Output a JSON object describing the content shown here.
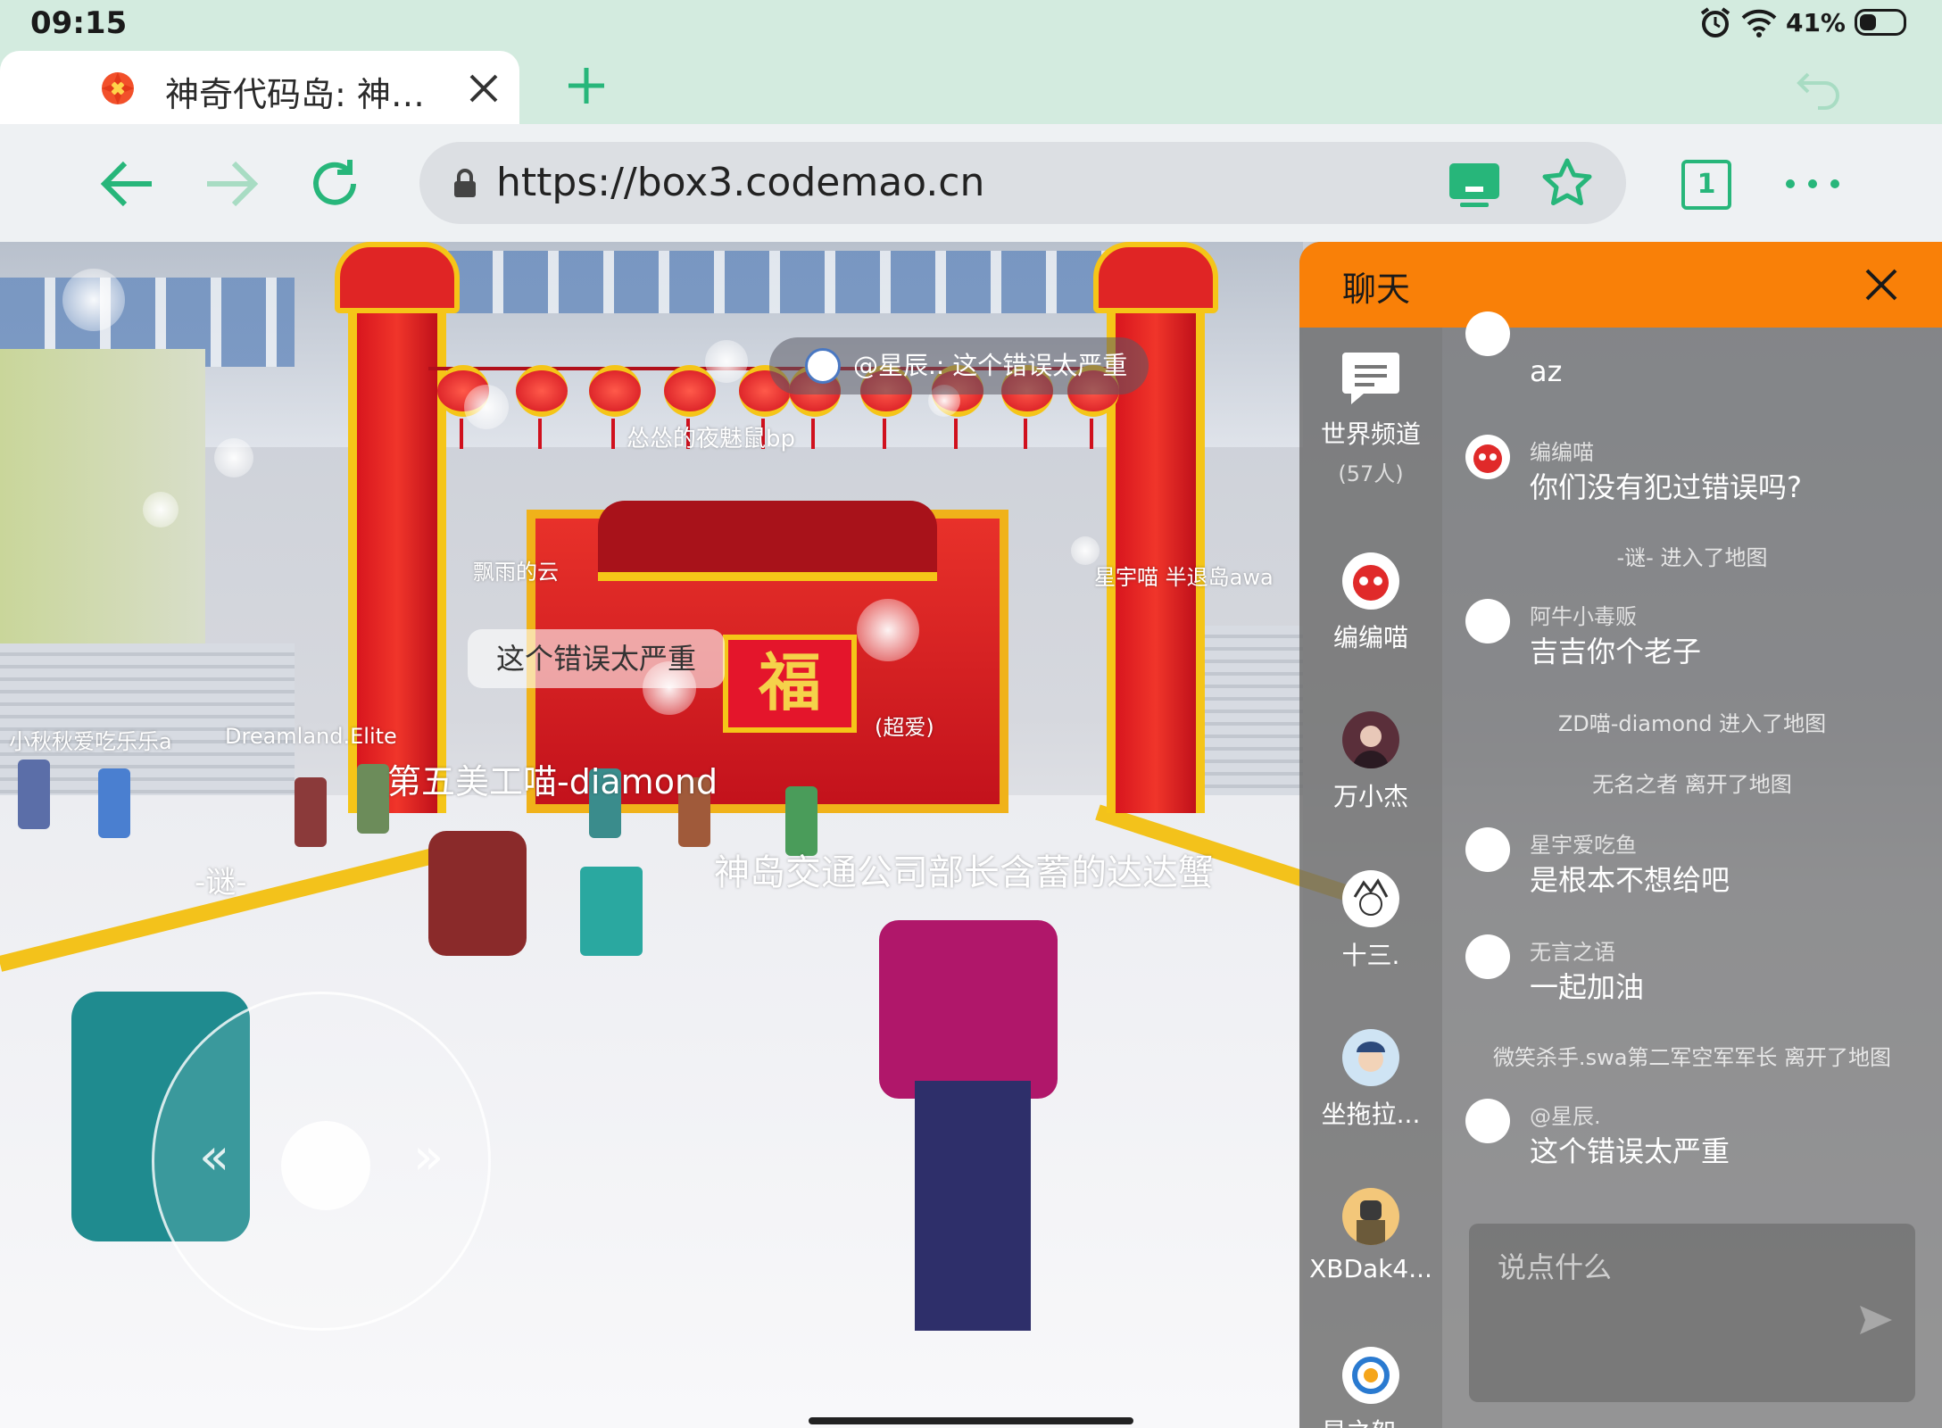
{
  "status": {
    "time": "09:15",
    "battery": "41%"
  },
  "tab": {
    "title": "神奇代码岛: 神…"
  },
  "address": {
    "url": "https://box3.codemao.cn",
    "tab_count": "1"
  },
  "game": {
    "top_bubble": "@星辰.: 这个错误太严重",
    "say_bubble": "这个错误太严重",
    "labels": {
      "l1": "怂怂的夜魅鼠bp",
      "l2": "飘雨的云",
      "l3": "星宇喵 半退岛awa",
      "l4": "小秋秋爱吃乐乐a",
      "l5": "Dreamland.Elite",
      "l6": "第五美工喵-diamond",
      "l7": "-谜-",
      "l8": "神岛交通公司部长含蓄的达达蟹",
      "l9": "星宇爱吃鱼",
      "l10": "(超爱)"
    }
  },
  "chat": {
    "title": "聊天",
    "channels": [
      {
        "name": "世界频道",
        "count": "(57人)"
      },
      {
        "name": "编编喵"
      },
      {
        "name": "万小杰"
      },
      {
        "name": "十三."
      },
      {
        "name": "坐拖拉..."
      },
      {
        "name": "XBDak4..."
      },
      {
        "name": "星之恕..."
      }
    ],
    "messages": [
      {
        "sender": "",
        "text": "az"
      },
      {
        "sender": "编编喵",
        "text": "你们没有犯过错误吗?"
      },
      {
        "system": "-谜- 进入了地图"
      },
      {
        "sender": "阿牛小毒贩",
        "text": "吉吉你个老子"
      },
      {
        "system": "ZD喵-diamond 进入了地图"
      },
      {
        "system": "无名之者 离开了地图"
      },
      {
        "sender": "星宇爱吃鱼",
        "text": "是根本不想给吧"
      },
      {
        "sender": "无言之语",
        "text": "一起加油"
      },
      {
        "system": "微笑杀手.swa第二军空军军长 离开了地图"
      },
      {
        "sender": "@星辰.",
        "text": "这个错误太严重"
      }
    ],
    "input_placeholder": "说点什么"
  },
  "colors": {
    "accent": "#27b67a",
    "chat_header": "#f98008"
  }
}
